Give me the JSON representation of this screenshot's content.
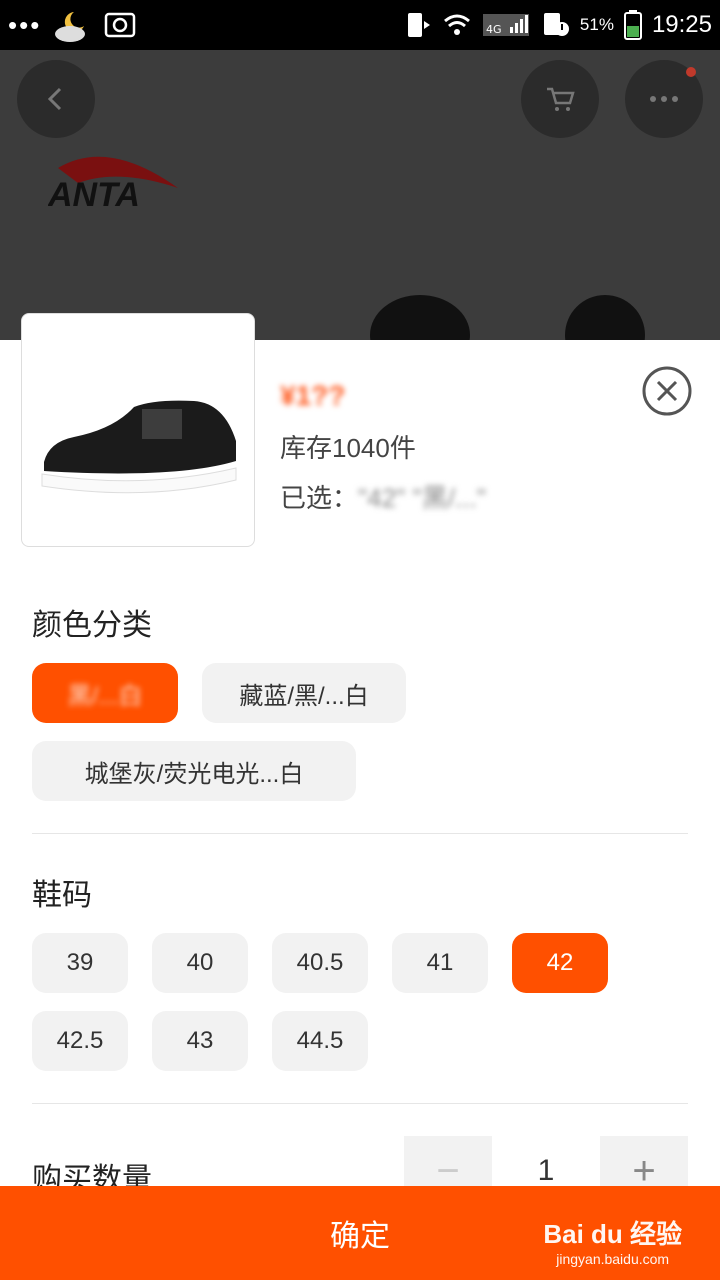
{
  "status_bar": {
    "battery_percent": "51%",
    "time": "19:25",
    "network": "4G"
  },
  "brand": {
    "logo_text": "ANTA"
  },
  "product": {
    "price": "¥1??",
    "stock": "库存1040件",
    "selected_label": "已选：",
    "selected_value": "\"42\" \"黑/...\""
  },
  "color_section": {
    "title": "颜色分类",
    "options": [
      {
        "label": "黑/...白",
        "active": true
      },
      {
        "label": "藏蓝/黑/...白",
        "active": false
      },
      {
        "label": "城堡灰/荧光电光...白",
        "active": false
      }
    ]
  },
  "size_section": {
    "title": "鞋码",
    "options": [
      "39",
      "40",
      "40.5",
      "41",
      "42",
      "42.5",
      "43",
      "44.5"
    ],
    "selected": "42"
  },
  "quantity_section": {
    "title": "购买数量",
    "value": "1",
    "minus": "−",
    "plus": "+"
  },
  "confirm_button": {
    "label": "确定"
  },
  "watermark": {
    "brand": "Bai du 经验",
    "url": "jingyan.baidu.com"
  },
  "colors": {
    "accent": "#ff5000",
    "chip_bg": "#f2f2f2",
    "overlay_bg": "#3c3c3c"
  }
}
